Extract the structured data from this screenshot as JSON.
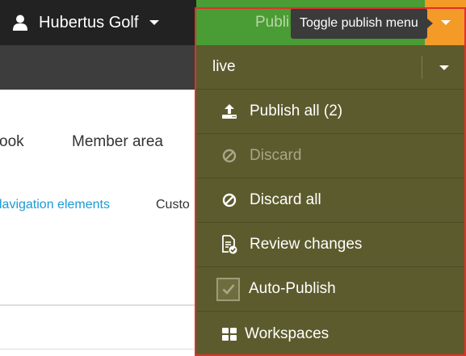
{
  "topbar": {
    "user_name": "Hubertus Golf",
    "publish_label": "Publi"
  },
  "tooltip": {
    "text": "Toggle publish menu"
  },
  "nav": {
    "items": [
      "ook",
      "Member area"
    ]
  },
  "subnav": {
    "items": [
      "lavigation elements",
      "Custo"
    ]
  },
  "publish_menu": {
    "workspace": "live",
    "items": {
      "publish_all": "Publish all (2)",
      "discard": "Discard",
      "discard_all": "Discard all",
      "review_changes": "Review changes",
      "auto_publish": "Auto-Publish",
      "workspaces": "Workspaces"
    },
    "auto_publish_checked": true,
    "discard_disabled": true
  },
  "colors": {
    "topbar": "#222222",
    "publish_green": "#4a9c34",
    "toggle_orange": "#f49a26",
    "menu_olive": "#5c5b2d",
    "link_blue": "#1a9ad6",
    "annotation_red": "#e0312d"
  },
  "icons": {
    "user": "user-icon",
    "publish_all": "upload-icon",
    "discard": "ban-icon",
    "review": "file-check-icon",
    "auto_publish": "checkbox-icon",
    "workspaces": "grid-icon"
  }
}
